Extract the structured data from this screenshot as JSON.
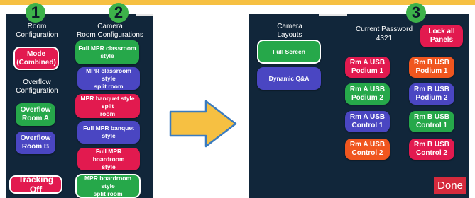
{
  "markers": [
    "1",
    "2",
    "3"
  ],
  "left_panel": {
    "room_config_label": "Room\nConfiguration",
    "mode_button": "Mode\n(Combined)",
    "overflow_config_label": "Overflow\nConfiguration",
    "overflow_room_a": "Overflow\nRoom A",
    "overflow_room_b": "Overflow\nRoom B",
    "tracking_button": "Tracking Off",
    "camera_room_config_label": "Camera\nRoom Configurations",
    "room_configs": [
      "Full MPR classroom\nstyle",
      "MPR classroom style\nsplit room",
      "MPR banquet style split\nroom",
      "Full MPR banquet style",
      "Full MPR boardroom\nstyle",
      "MPR boardroom style\nsplit room"
    ]
  },
  "right_panel": {
    "camera_layouts_label": "Camera\nLayouts",
    "layouts": [
      "Full Screen",
      "Dynamic Q&A"
    ],
    "password_label": "Current Password",
    "password_value": "4321",
    "lock_button": "Lock all\nPanels",
    "usb_buttons": [
      "Rm A USB\nPodium 1",
      "Rm B USB\nPodium 1",
      "Rm A USB\nPodium 2",
      "Rm B USB\nPodium 2",
      "Rm A USB\nControl 1",
      "Rm B USB\nControl 1",
      "Rm A USB\nControl 2",
      "Rm B USB\nControl 2"
    ],
    "done_button": "Done"
  },
  "colors": {
    "panel": "#11263a",
    "red": "#e21a4f",
    "green": "#26a84a",
    "purple": "#4a46c2",
    "orange": "#f0561f",
    "arrow_fill": "#f6c042",
    "arrow_stroke": "#3a7bbf",
    "marker": "#3db24a"
  }
}
